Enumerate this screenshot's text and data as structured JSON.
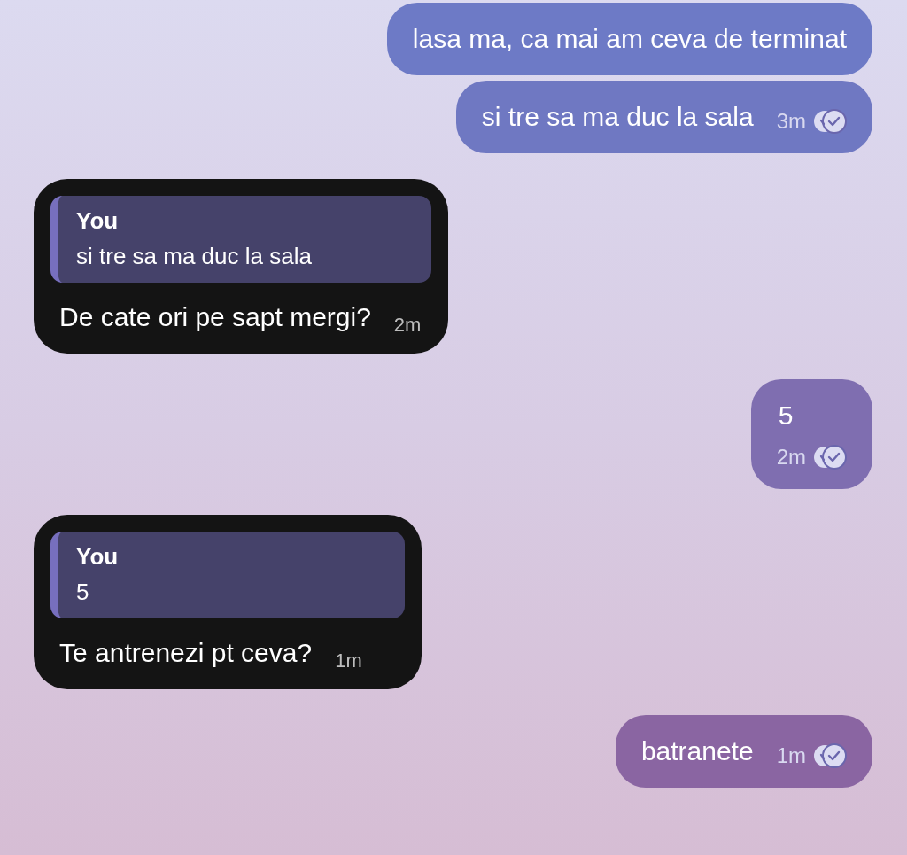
{
  "messages": [
    {
      "kind": "outgoing",
      "text": "lasa ma, ca mai am ceva de terminat"
    },
    {
      "kind": "outgoing",
      "text": "si tre sa ma duc la sala",
      "time": "3m",
      "read": true
    },
    {
      "kind": "incoming",
      "reply": {
        "author": "You",
        "text": "si tre sa ma duc la sala"
      },
      "text": "De cate ori pe sapt mergi?",
      "time": "2m"
    },
    {
      "kind": "outgoing",
      "text": "5",
      "time": "2m",
      "read": true
    },
    {
      "kind": "incoming",
      "reply": {
        "author": "You",
        "text": "5"
      },
      "text": "Te antrenezi pt ceva?",
      "time": "1m"
    },
    {
      "kind": "outgoing",
      "text": "batranete",
      "time": "1m",
      "read": true
    }
  ]
}
